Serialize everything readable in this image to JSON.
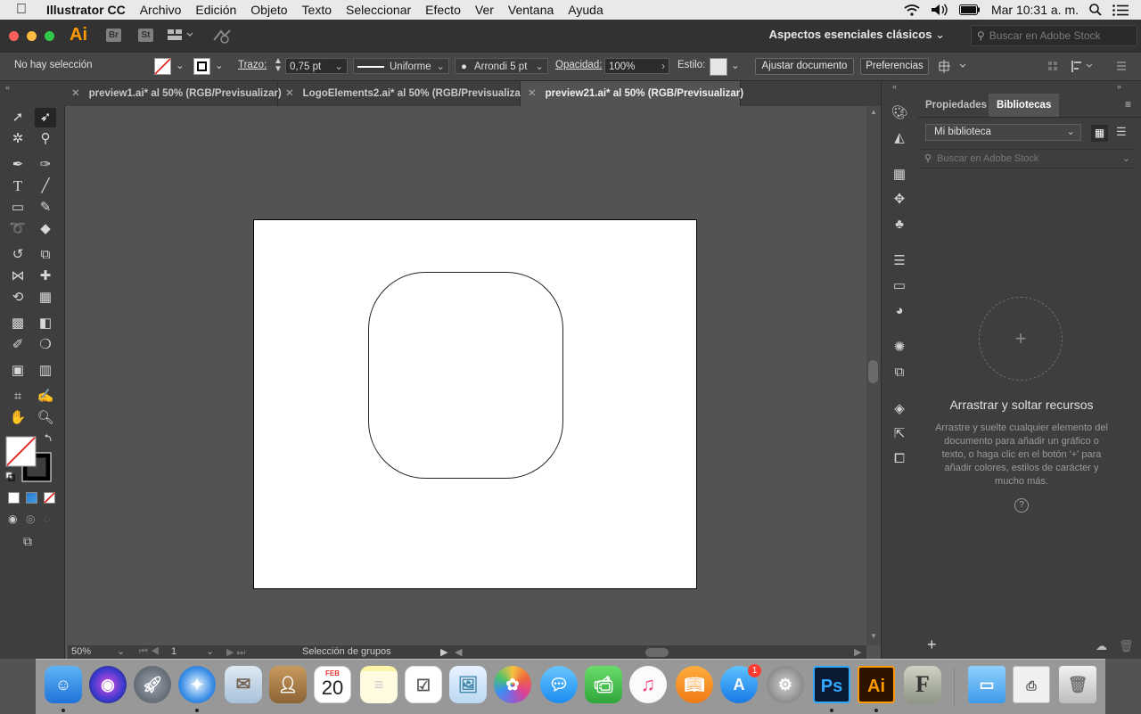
{
  "menubar": {
    "apple": "",
    "app_name": "Illustrator CC",
    "items": [
      "Archivo",
      "Edición",
      "Objeto",
      "Texto",
      "Seleccionar",
      "Efecto",
      "Ver",
      "Ventana",
      "Ayuda"
    ],
    "clock": "Mar 10:31 a. m."
  },
  "appbar": {
    "logo": "Ai",
    "bridge": "Br",
    "stock": "St",
    "workspace": "Aspectos esenciales clásicos",
    "search_placeholder": "Buscar en Adobe Stock"
  },
  "control": {
    "selection": "No hay selección",
    "stroke_label": "Trazo:",
    "stroke_weight": "0,75 pt",
    "profile": "Uniforme",
    "brush": "Arrondi 5 pt",
    "opacity_label": "Opacidad:",
    "opacity": "100%",
    "style_label": "Estilo:",
    "fit_button": "Ajustar documento",
    "prefs_button": "Preferencias"
  },
  "tabs": [
    {
      "label": "preview1.ai* al 50% (RGB/Previsualizar)"
    },
    {
      "label": "LogoElements2.ai* al 50% (RGB/Previsualizar)"
    },
    {
      "label": "preview21.ai* al 50% (RGB/Previsualizar)"
    }
  ],
  "status": {
    "zoom": "50%",
    "page": "1",
    "tool": "Selección de grupos"
  },
  "panel": {
    "tab_properties": "Propiedades",
    "tab_libraries": "Bibliotecas",
    "library": "Mi biblioteca",
    "search_placeholder": "Buscar en Adobe Stock",
    "drop_title": "Arrastrar y soltar recursos",
    "drop_desc": "Arrastre y suelte cualquier elemento del documento para añadir un gráfico o texto, o haga clic en el botón '+' para añadir colores, estilos de carácter y mucho más.",
    "plus": "+"
  },
  "dock": {
    "calendar_month": "FEB",
    "calendar_day": "20",
    "appstore_badge": "1",
    "ps": "Ps",
    "ai": "Ai"
  }
}
